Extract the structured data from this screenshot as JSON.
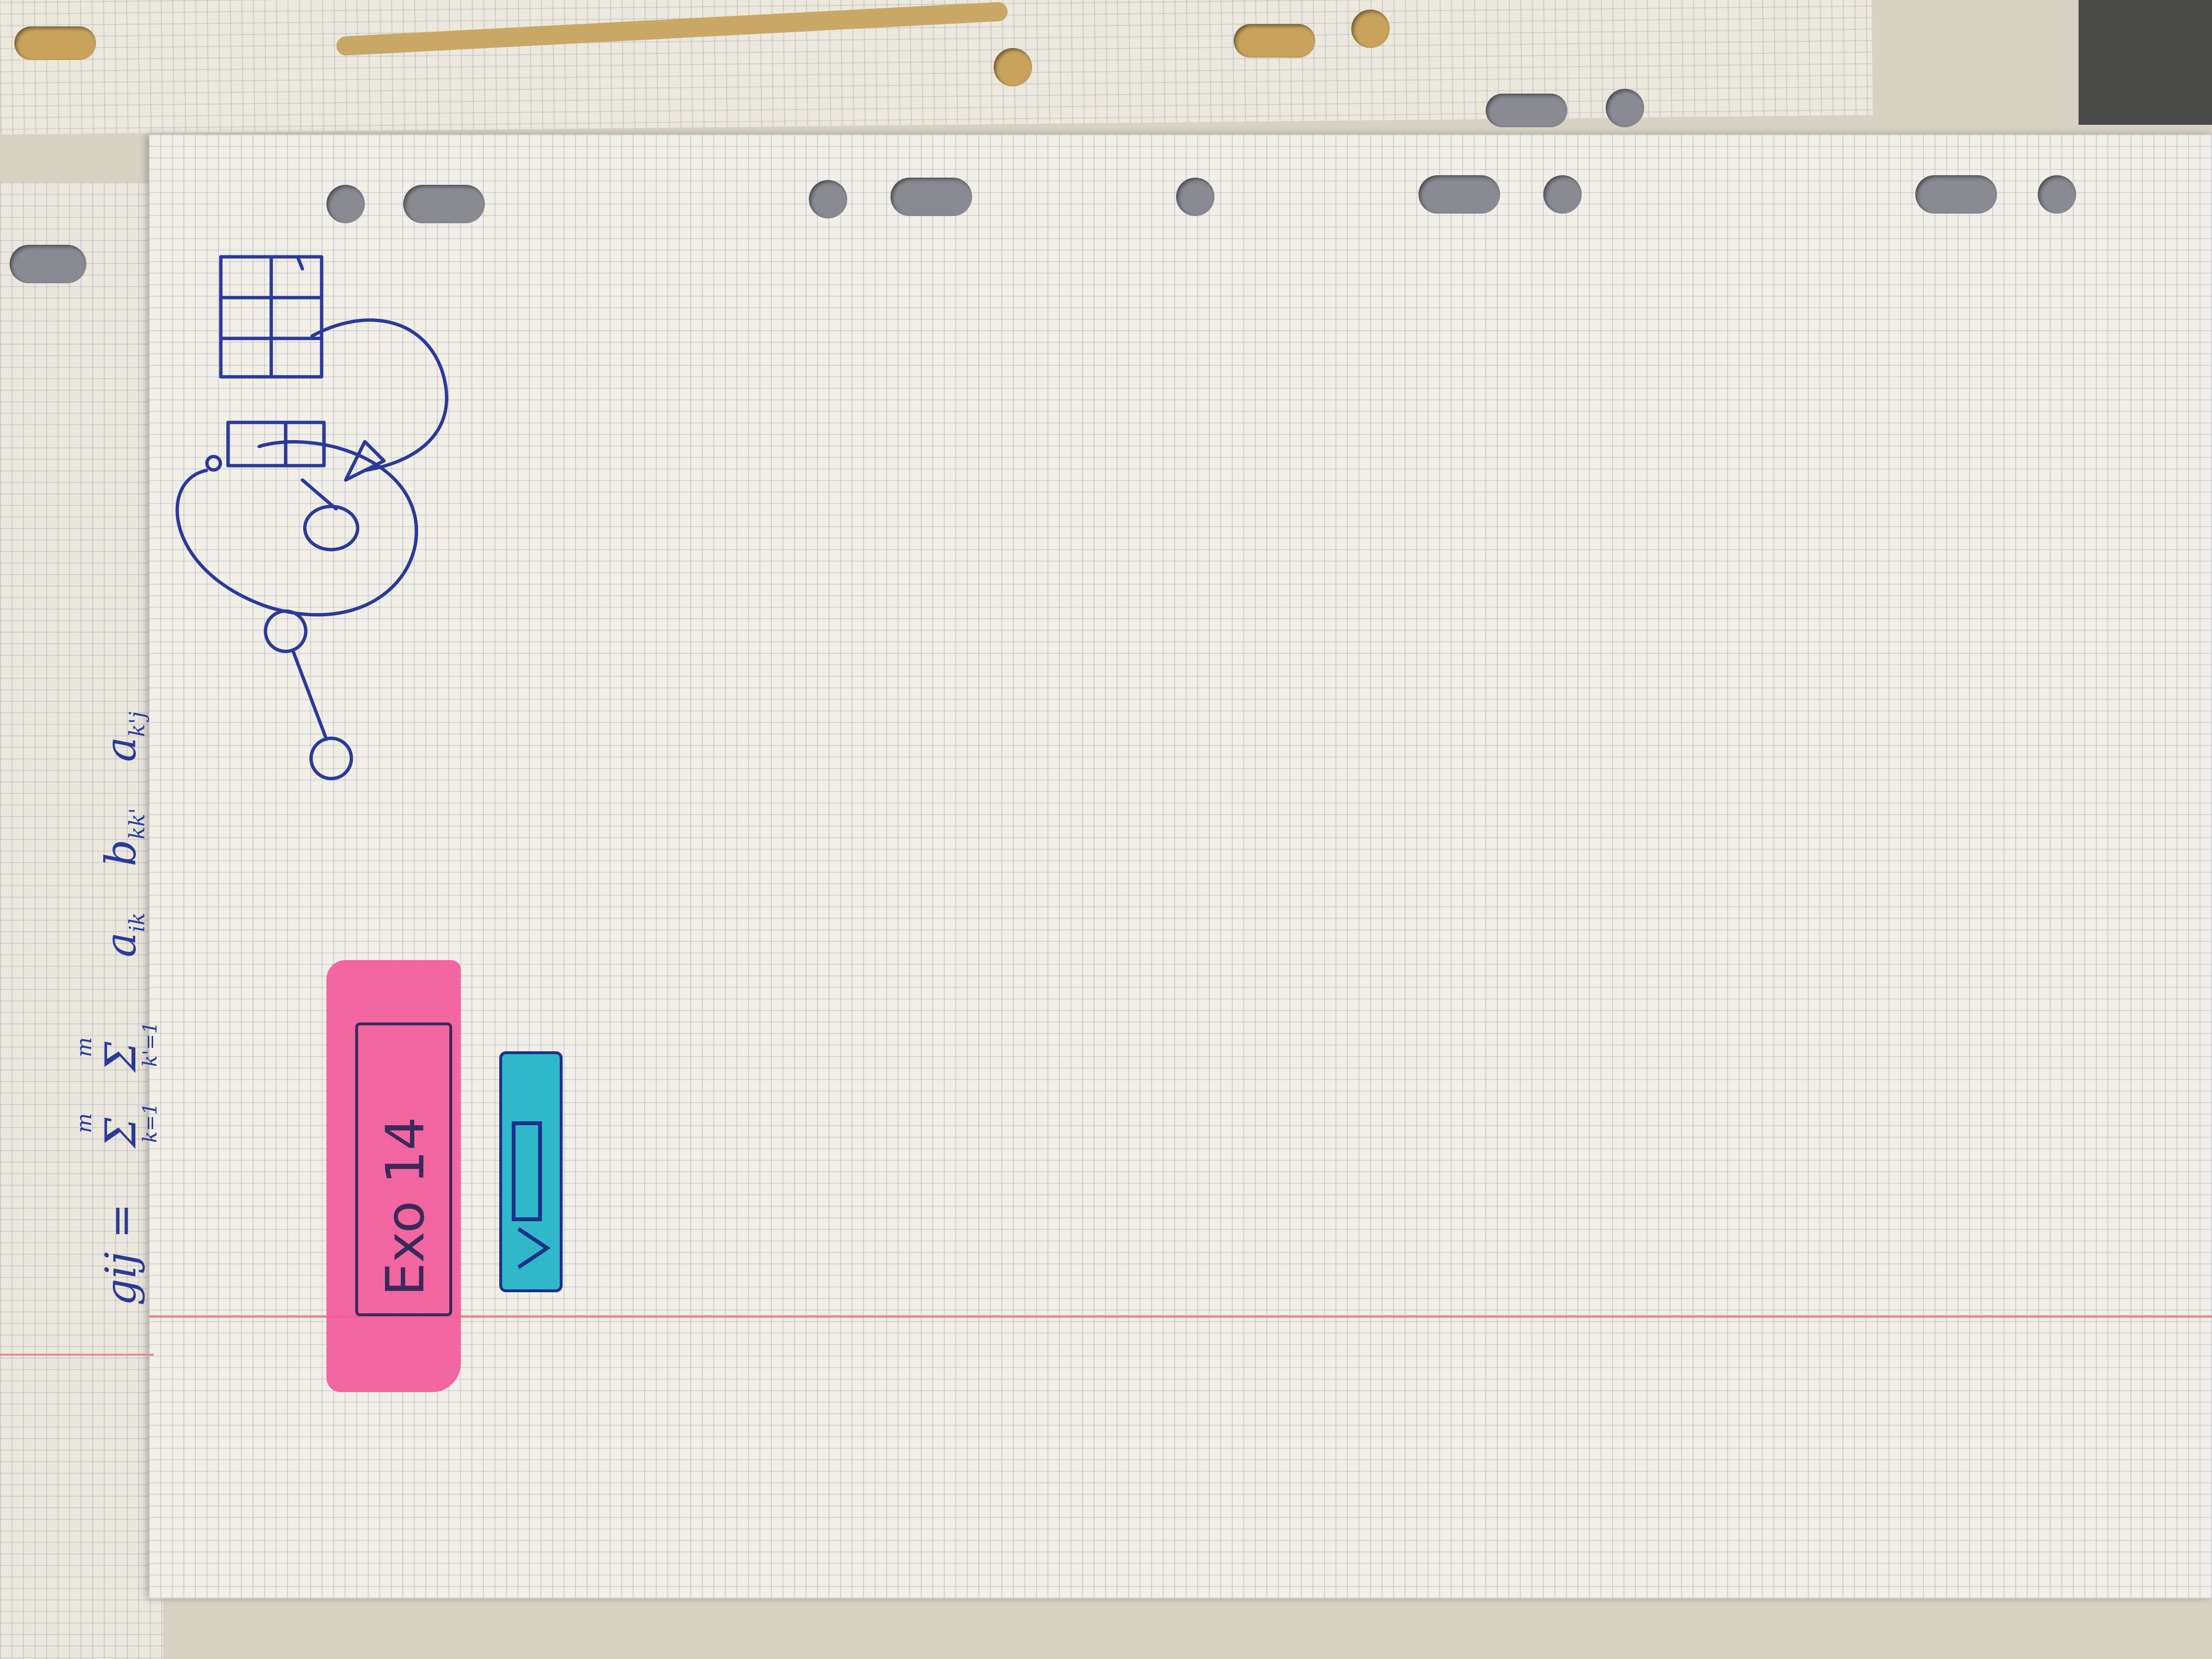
{
  "formula": {
    "lhs": "gij =",
    "sum1": "Σ",
    "sum1_upper": "m",
    "sum1_lower": "k=1",
    "sum2": "Σ",
    "sum2_upper": "m",
    "sum2_lower": "k'=1",
    "term_a": "a",
    "term_a_sub": "ik",
    "term_b": "b",
    "term_b_sub": "kk'",
    "term_c": "a",
    "term_c_sub": "k'j"
  },
  "pink_label": {
    "text": "Exo 14",
    "color": "#f25a9b"
  },
  "colors": {
    "ink": "#2a3a9a",
    "highlight_pink": "#f25a9b",
    "highlight_cyan": "#2fb8c9",
    "paper": "#f1efe6",
    "margin_red": "#e98a8a"
  },
  "icons": [
    "hole-punch-icon"
  ]
}
